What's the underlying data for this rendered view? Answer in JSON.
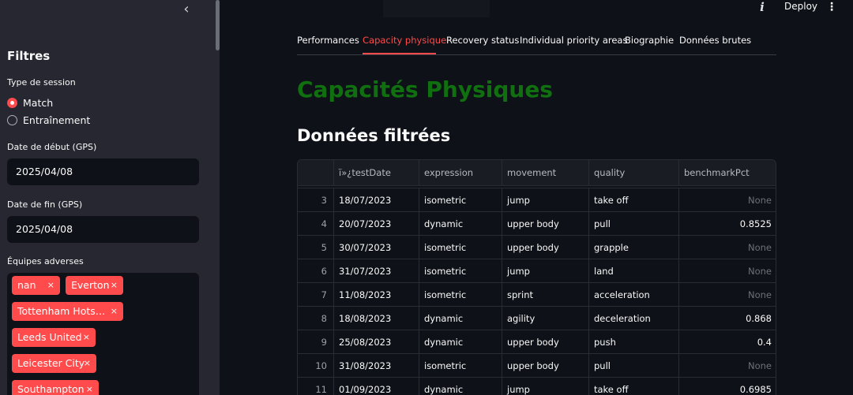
{
  "sidebar": {
    "title": "Filtres",
    "collapse_icon": "‹",
    "session_label": "Type de session",
    "session_options": [
      {
        "label": "Match",
        "selected": true
      },
      {
        "label": "Entraînement",
        "selected": false
      }
    ],
    "start_date_label": "Date de début (GPS)",
    "start_date_value": "2025/04/08",
    "end_date_label": "Date de fin (GPS)",
    "end_date_value": "2025/04/08",
    "teams_label": "Équipes adverses",
    "teams": [
      "nan",
      "Everton",
      "Tottenham Hots…",
      "Leeds United",
      "Leicester City",
      "Southampton"
    ],
    "tag_remove_icon": "×"
  },
  "header": {
    "info_icon": "i",
    "deploy_label": "Deploy",
    "menu_icon": "⋮"
  },
  "tabs": [
    {
      "label": "Performances",
      "active": false
    },
    {
      "label": "Capacity physique",
      "active": true
    },
    {
      "label": "Recovery status",
      "active": false
    },
    {
      "label": "Individual priority areas",
      "active": false
    },
    {
      "label": "Biographie",
      "active": false
    },
    {
      "label": "Données brutes",
      "active": false
    }
  ],
  "main": {
    "title": "Capacités Physiques",
    "subtitle": "Données filtrées"
  },
  "table": {
    "columns": [
      "",
      "ï»¿testDate",
      "expression",
      "movement",
      "quality",
      "benchmarkPct"
    ],
    "rows": [
      [
        "3",
        "18/07/2023",
        "isometric",
        "jump",
        "take off",
        "None"
      ],
      [
        "4",
        "20/07/2023",
        "dynamic",
        "upper body",
        "pull",
        "0.8525"
      ],
      [
        "5",
        "30/07/2023",
        "isometric",
        "upper body",
        "grapple",
        "None"
      ],
      [
        "6",
        "31/07/2023",
        "isometric",
        "jump",
        "land",
        "None"
      ],
      [
        "7",
        "11/08/2023",
        "isometric",
        "sprint",
        "acceleration",
        "None"
      ],
      [
        "8",
        "18/08/2023",
        "dynamic",
        "agility",
        "deceleration",
        "0.868"
      ],
      [
        "9",
        "25/08/2023",
        "dynamic",
        "upper body",
        "push",
        "0.4"
      ],
      [
        "10",
        "31/08/2023",
        "isometric",
        "upper body",
        "pull",
        "None"
      ],
      [
        "11",
        "01/09/2023",
        "dynamic",
        "jump",
        "take off",
        "0.6985"
      ]
    ]
  },
  "colors": {
    "accent": "#ff4b4b",
    "title_green": "#107010",
    "sidebar_bg": "#262730",
    "main_bg": "#0e1117"
  }
}
